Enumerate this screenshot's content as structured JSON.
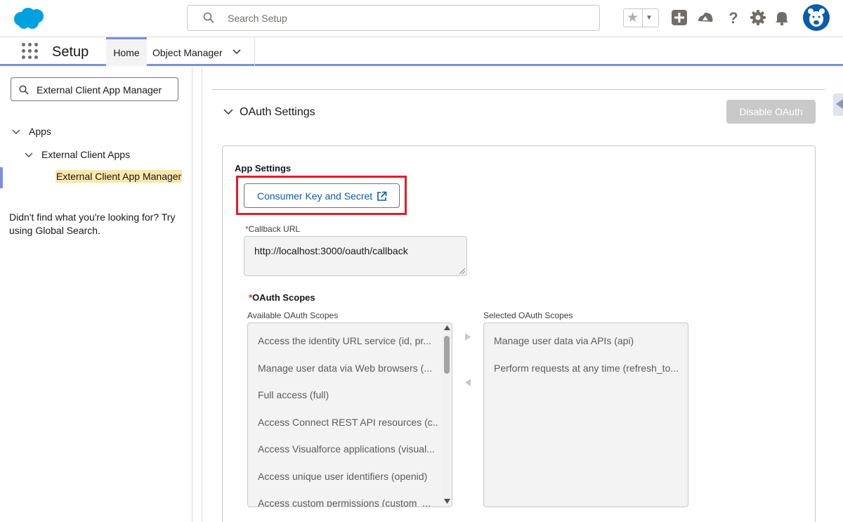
{
  "header": {
    "search_placeholder": "Search Setup",
    "icons": [
      "salesforce-cloud-logo",
      "search-icon",
      "star-icon",
      "caret-down-icon",
      "plus-icon",
      "trailhead-icon",
      "help-icon",
      "gear-icon",
      "bell-icon",
      "user-avatar"
    ],
    "brand_color": "#00a1e0"
  },
  "nav": {
    "app_name": "Setup",
    "tabs": [
      {
        "label": "Home",
        "active": true
      },
      {
        "label": "Object Manager",
        "has_dropdown": true
      }
    ],
    "accent_color": "#7b8fe0"
  },
  "sidebar": {
    "quick_find_value": "External Client App Manager",
    "tree": [
      {
        "label": "Apps",
        "expanded": true
      },
      {
        "label": "External Client Apps",
        "expanded": true
      },
      {
        "label": "External Client App Manager",
        "selected": true
      }
    ],
    "hint": "Didn't find what you're looking for? Try using Global Search."
  },
  "main": {
    "section_title": "OAuth Settings",
    "disable_button": "Disable OAuth",
    "app_settings_title": "App Settings",
    "consumer_button": "Consumer Key and Secret",
    "required_mark": "*",
    "callback_label": "Callback URL",
    "callback_value": "http://localhost:3000/oauth/callback",
    "scopes_title": "OAuth Scopes",
    "available_label": "Available OAuth Scopes",
    "selected_label": "Selected OAuth Scopes",
    "available_scopes": [
      "Access the identity URL service (id, pr...",
      "Manage user data via Web browsers (...",
      "Full access (full)",
      "Access Connect REST API resources (c...",
      "Access Visualforce applications (visual...",
      "Access unique user identifiers (openid)",
      "Access custom permissions (custom_..."
    ],
    "selected_scopes": [
      "Manage user data via APIs (api)",
      "Perform requests at any time (refresh_to..."
    ],
    "highlight_color": "#e01f2a"
  }
}
